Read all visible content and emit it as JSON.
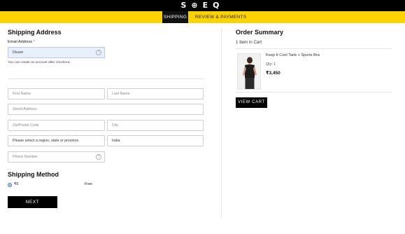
{
  "brand": {
    "logo_text": "S⊕EQ"
  },
  "steps": {
    "active": "SHIPPING",
    "next": "REVIEW & PAYMENTS"
  },
  "shipping": {
    "title": "Shipping Address",
    "email_label": "Email Address",
    "required_mark": "*",
    "email_value": "Diuser",
    "email_hint": "You can create an account after checkout.",
    "first_name_placeholder": "First Name",
    "last_name_placeholder": "Last Name",
    "street_placeholder": "Street Address",
    "zip_placeholder": "Zip/Postal Code",
    "city_placeholder": "City",
    "region_value": "Please select a region, state or province.",
    "country_value": "India",
    "phone_placeholder": "Phone Number",
    "help_icon": "?"
  },
  "method": {
    "title": "Shipping Method",
    "price": "₹0",
    "carrier": "Free"
  },
  "next_button": "NEXT",
  "summary": {
    "title": "Order Summary",
    "cart_count": "1 Item in Cart",
    "product_name": "Keep It Cool Tank + Sports Bra",
    "qty": "Qty: 1",
    "price": "₹3,450",
    "view_cart": "VIEW CART"
  },
  "colors": {
    "accent_yellow": "#fcd200",
    "black": "#000000",
    "autofill_blue": "#e8f0fe"
  },
  "icons": {
    "help": "question-circle-icon",
    "radio": "radio-selected-icon"
  }
}
